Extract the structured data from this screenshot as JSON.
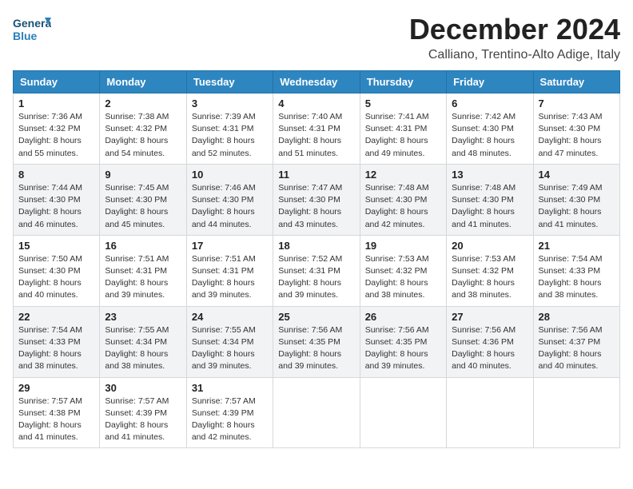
{
  "logo": {
    "general": "General",
    "blue": "Blue"
  },
  "header": {
    "title": "December 2024",
    "subtitle": "Calliano, Trentino-Alto Adige, Italy"
  },
  "weekdays": [
    "Sunday",
    "Monday",
    "Tuesday",
    "Wednesday",
    "Thursday",
    "Friday",
    "Saturday"
  ],
  "weeks": [
    [
      {
        "day": "1",
        "sunrise": "Sunrise: 7:36 AM",
        "sunset": "Sunset: 4:32 PM",
        "daylight": "Daylight: 8 hours and 55 minutes."
      },
      {
        "day": "2",
        "sunrise": "Sunrise: 7:38 AM",
        "sunset": "Sunset: 4:32 PM",
        "daylight": "Daylight: 8 hours and 54 minutes."
      },
      {
        "day": "3",
        "sunrise": "Sunrise: 7:39 AM",
        "sunset": "Sunset: 4:31 PM",
        "daylight": "Daylight: 8 hours and 52 minutes."
      },
      {
        "day": "4",
        "sunrise": "Sunrise: 7:40 AM",
        "sunset": "Sunset: 4:31 PM",
        "daylight": "Daylight: 8 hours and 51 minutes."
      },
      {
        "day": "5",
        "sunrise": "Sunrise: 7:41 AM",
        "sunset": "Sunset: 4:31 PM",
        "daylight": "Daylight: 8 hours and 49 minutes."
      },
      {
        "day": "6",
        "sunrise": "Sunrise: 7:42 AM",
        "sunset": "Sunset: 4:30 PM",
        "daylight": "Daylight: 8 hours and 48 minutes."
      },
      {
        "day": "7",
        "sunrise": "Sunrise: 7:43 AM",
        "sunset": "Sunset: 4:30 PM",
        "daylight": "Daylight: 8 hours and 47 minutes."
      }
    ],
    [
      {
        "day": "8",
        "sunrise": "Sunrise: 7:44 AM",
        "sunset": "Sunset: 4:30 PM",
        "daylight": "Daylight: 8 hours and 46 minutes."
      },
      {
        "day": "9",
        "sunrise": "Sunrise: 7:45 AM",
        "sunset": "Sunset: 4:30 PM",
        "daylight": "Daylight: 8 hours and 45 minutes."
      },
      {
        "day": "10",
        "sunrise": "Sunrise: 7:46 AM",
        "sunset": "Sunset: 4:30 PM",
        "daylight": "Daylight: 8 hours and 44 minutes."
      },
      {
        "day": "11",
        "sunrise": "Sunrise: 7:47 AM",
        "sunset": "Sunset: 4:30 PM",
        "daylight": "Daylight: 8 hours and 43 minutes."
      },
      {
        "day": "12",
        "sunrise": "Sunrise: 7:48 AM",
        "sunset": "Sunset: 4:30 PM",
        "daylight": "Daylight: 8 hours and 42 minutes."
      },
      {
        "day": "13",
        "sunrise": "Sunrise: 7:48 AM",
        "sunset": "Sunset: 4:30 PM",
        "daylight": "Daylight: 8 hours and 41 minutes."
      },
      {
        "day": "14",
        "sunrise": "Sunrise: 7:49 AM",
        "sunset": "Sunset: 4:30 PM",
        "daylight": "Daylight: 8 hours and 41 minutes."
      }
    ],
    [
      {
        "day": "15",
        "sunrise": "Sunrise: 7:50 AM",
        "sunset": "Sunset: 4:30 PM",
        "daylight": "Daylight: 8 hours and 40 minutes."
      },
      {
        "day": "16",
        "sunrise": "Sunrise: 7:51 AM",
        "sunset": "Sunset: 4:31 PM",
        "daylight": "Daylight: 8 hours and 39 minutes."
      },
      {
        "day": "17",
        "sunrise": "Sunrise: 7:51 AM",
        "sunset": "Sunset: 4:31 PM",
        "daylight": "Daylight: 8 hours and 39 minutes."
      },
      {
        "day": "18",
        "sunrise": "Sunrise: 7:52 AM",
        "sunset": "Sunset: 4:31 PM",
        "daylight": "Daylight: 8 hours and 39 minutes."
      },
      {
        "day": "19",
        "sunrise": "Sunrise: 7:53 AM",
        "sunset": "Sunset: 4:32 PM",
        "daylight": "Daylight: 8 hours and 38 minutes."
      },
      {
        "day": "20",
        "sunrise": "Sunrise: 7:53 AM",
        "sunset": "Sunset: 4:32 PM",
        "daylight": "Daylight: 8 hours and 38 minutes."
      },
      {
        "day": "21",
        "sunrise": "Sunrise: 7:54 AM",
        "sunset": "Sunset: 4:33 PM",
        "daylight": "Daylight: 8 hours and 38 minutes."
      }
    ],
    [
      {
        "day": "22",
        "sunrise": "Sunrise: 7:54 AM",
        "sunset": "Sunset: 4:33 PM",
        "daylight": "Daylight: 8 hours and 38 minutes."
      },
      {
        "day": "23",
        "sunrise": "Sunrise: 7:55 AM",
        "sunset": "Sunset: 4:34 PM",
        "daylight": "Daylight: 8 hours and 38 minutes."
      },
      {
        "day": "24",
        "sunrise": "Sunrise: 7:55 AM",
        "sunset": "Sunset: 4:34 PM",
        "daylight": "Daylight: 8 hours and 39 minutes."
      },
      {
        "day": "25",
        "sunrise": "Sunrise: 7:56 AM",
        "sunset": "Sunset: 4:35 PM",
        "daylight": "Daylight: 8 hours and 39 minutes."
      },
      {
        "day": "26",
        "sunrise": "Sunrise: 7:56 AM",
        "sunset": "Sunset: 4:35 PM",
        "daylight": "Daylight: 8 hours and 39 minutes."
      },
      {
        "day": "27",
        "sunrise": "Sunrise: 7:56 AM",
        "sunset": "Sunset: 4:36 PM",
        "daylight": "Daylight: 8 hours and 40 minutes."
      },
      {
        "day": "28",
        "sunrise": "Sunrise: 7:56 AM",
        "sunset": "Sunset: 4:37 PM",
        "daylight": "Daylight: 8 hours and 40 minutes."
      }
    ],
    [
      {
        "day": "29",
        "sunrise": "Sunrise: 7:57 AM",
        "sunset": "Sunset: 4:38 PM",
        "daylight": "Daylight: 8 hours and 41 minutes."
      },
      {
        "day": "30",
        "sunrise": "Sunrise: 7:57 AM",
        "sunset": "Sunset: 4:39 PM",
        "daylight": "Daylight: 8 hours and 41 minutes."
      },
      {
        "day": "31",
        "sunrise": "Sunrise: 7:57 AM",
        "sunset": "Sunset: 4:39 PM",
        "daylight": "Daylight: 8 hours and 42 minutes."
      },
      null,
      null,
      null,
      null
    ]
  ]
}
